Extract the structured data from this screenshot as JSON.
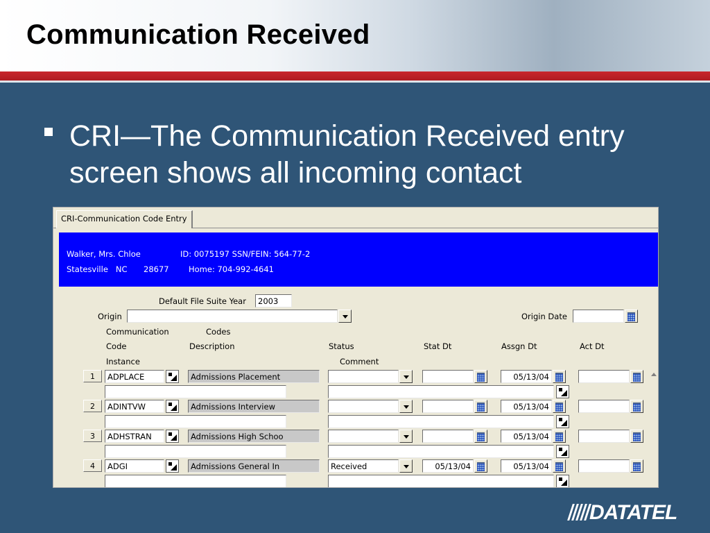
{
  "slide": {
    "title": "Communication Received",
    "bullet": "CRI—The Communication Received entry screen shows all incoming contact",
    "logo": "DATATEL"
  },
  "window": {
    "tab_label": "CRI-Communication Code Entry",
    "person": {
      "name": "Walker, Mrs. Chloe",
      "id_line": "ID: 0075197 SSN/FEIN: 564-77-2",
      "city_state": "Statesville   NC",
      "zip": "28677",
      "home_phone": "Home: 704-992-4641"
    },
    "form": {
      "default_file_suite_year_label": "Default File Suite Year",
      "default_file_suite_year": "2003",
      "origin_label": "Origin",
      "origin_value": "",
      "origin_date_label": "Origin Date",
      "origin_date_value": ""
    },
    "columns": {
      "communication": "Communication",
      "codes": "Codes",
      "code": "Code",
      "description": "Description",
      "status": "Status",
      "stat_dt": "Stat Dt",
      "assgn_dt": "Assgn Dt",
      "act_dt": "Act Dt",
      "instance": "Instance",
      "comment": "Comment"
    },
    "rows": [
      {
        "num": "1",
        "code": "ADPLACE",
        "description": "Admissions Placement",
        "status": "",
        "stat_dt": "",
        "assgn_dt": "05/13/04",
        "act_dt": "",
        "instance": "",
        "comment": ""
      },
      {
        "num": "2",
        "code": "ADINTVW",
        "description": "Admissions Interview",
        "status": "",
        "stat_dt": "",
        "assgn_dt": "05/13/04",
        "act_dt": "",
        "instance": "",
        "comment": ""
      },
      {
        "num": "3",
        "code": "ADHSTRAN",
        "description": "Admissions High Schoo",
        "status": "",
        "stat_dt": "",
        "assgn_dt": "05/13/04",
        "act_dt": "",
        "instance": "",
        "comment": ""
      },
      {
        "num": "4",
        "code": "ADGI",
        "description": "Admissions General In",
        "status": "Received",
        "stat_dt": "05/13/04",
        "assgn_dt": "05/13/04",
        "act_dt": "",
        "instance": "",
        "comment": ""
      }
    ],
    "colors": {
      "banner": "#0000ff",
      "slide_background": "#2f5577",
      "accent_bar": "#c8262c"
    }
  }
}
